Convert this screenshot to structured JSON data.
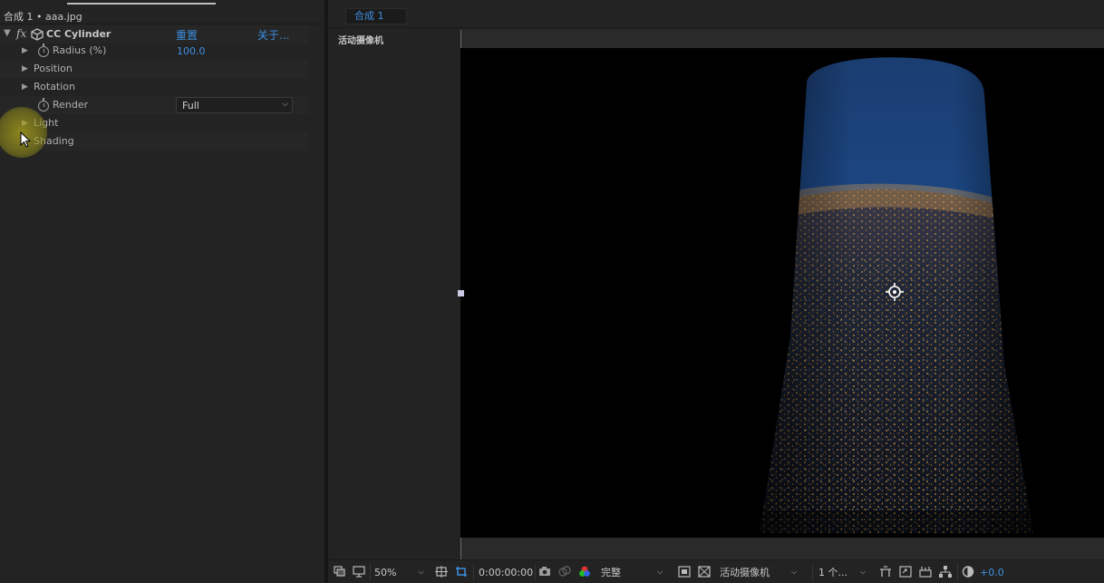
{
  "effect_controls": {
    "header": "合成 1 • aaa.jpg",
    "effect": {
      "fx": "fx",
      "name": "CC Cylinder",
      "reset": "重置",
      "about": "关于..."
    },
    "properties": [
      {
        "label": "Radius (%)",
        "value": "100.0"
      },
      {
        "label": "Position"
      },
      {
        "label": "Rotation"
      },
      {
        "label": "Render",
        "value": "Full"
      },
      {
        "label": "Light"
      },
      {
        "label": "Shading"
      }
    ]
  },
  "composition": {
    "tab": "合成 1",
    "view_label": "活动摄像机"
  },
  "toolbar": {
    "zoom": "50%",
    "timecode": "0:00:00:00",
    "resolution": "完整",
    "camera": "活动摄像机",
    "views": "1 个...",
    "exposure": "+0.0"
  },
  "colors": {
    "accent_blue": "#3d8fe0",
    "panel_bg": "#232323",
    "viewport_bg": "#000000"
  }
}
